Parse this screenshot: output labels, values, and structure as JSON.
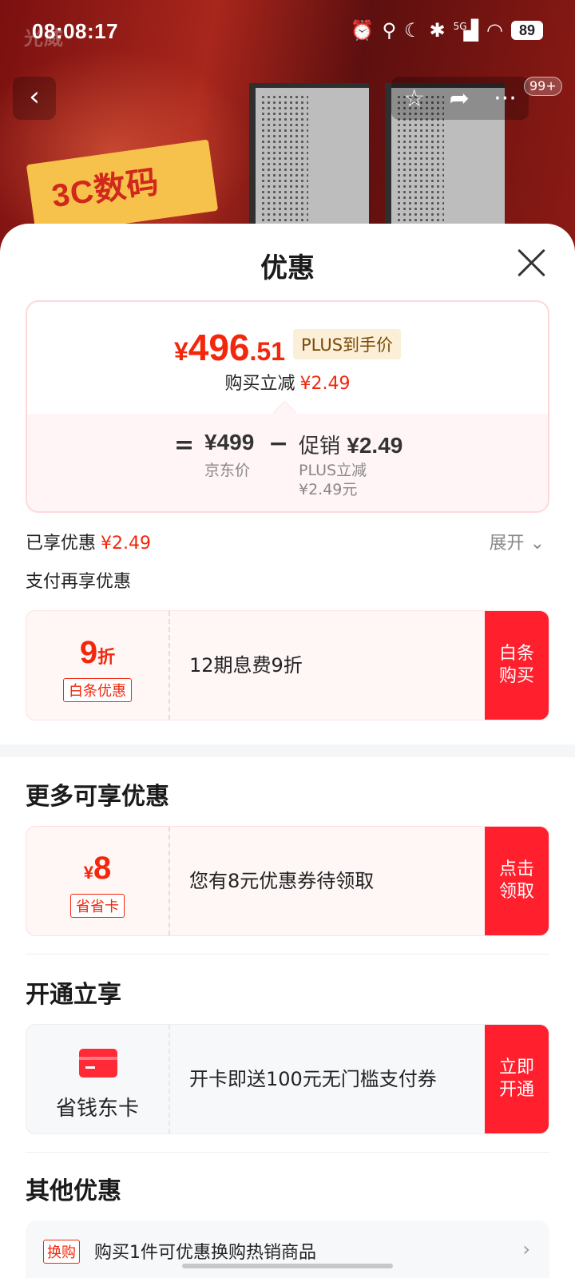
{
  "status_bar": {
    "time": "08:08:17",
    "network": "5G",
    "battery": "89"
  },
  "hero": {
    "watermark": "光威",
    "sign_text": "3C数码",
    "message_badge": "99+"
  },
  "sheet": {
    "title": "优惠",
    "price_card": {
      "currency": "¥",
      "price_integer": "496",
      "price_decimal": ".51",
      "price_tag": "PLUS到手价",
      "reduce_label": "购买立减",
      "reduce_amount": "¥2.49",
      "equals": "=",
      "jd_price": "¥499",
      "jd_label": "京东价",
      "minus": "−",
      "promo_label": "促销",
      "promo_amount": "¥2.49",
      "promo_sub1": "PLUS立减",
      "promo_sub2": "¥2.49元"
    },
    "enjoyed_label": "已享优惠",
    "enjoyed_amount": "¥2.49",
    "expand_label": "展开",
    "pay_more_label": "支付再享优惠",
    "baitiao": {
      "value": "9",
      "unit": "折",
      "tag": "白条优惠",
      "description": "12期息费9折",
      "cta": "白条购买"
    },
    "more_title": "更多可享优惠",
    "coupon": {
      "unit": "¥",
      "value": "8",
      "tag": "省省卡",
      "description": "您有8元优惠券待领取",
      "cta": "点击领取"
    },
    "open_title": "开通立享",
    "card": {
      "name": "省钱东卡",
      "description": "开卡即送100元无门槛支付券",
      "cta": "立即开通"
    },
    "other_title": "其他优惠",
    "other": {
      "tag": "换购",
      "text": "购买1件可优惠换购热销商品"
    }
  }
}
